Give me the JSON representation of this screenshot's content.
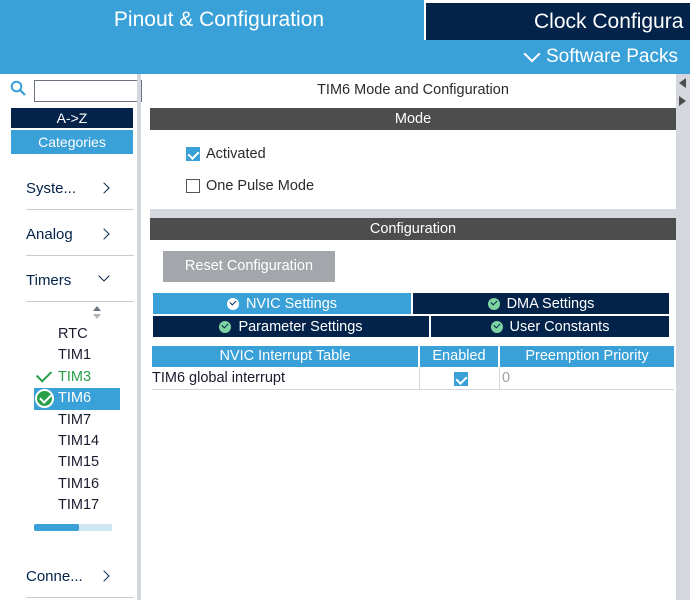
{
  "header": {
    "tab_pinout": "Pinout & Configuration",
    "tab_clock": "Clock Configura",
    "software_packs": "Software Packs"
  },
  "sidebar": {
    "search_placeholder": "",
    "az_label": "A->Z",
    "categories_label": "Categories",
    "groups": [
      {
        "label": "Syste...",
        "state": "collapsed"
      },
      {
        "label": "Analog",
        "state": "collapsed"
      },
      {
        "label": "Timers",
        "state": "expanded"
      }
    ],
    "timers": [
      {
        "label": "RTC",
        "status": "none"
      },
      {
        "label": "TIM1",
        "status": "none"
      },
      {
        "label": "TIM3",
        "status": "configured"
      },
      {
        "label": "TIM6",
        "status": "selected"
      },
      {
        "label": "TIM7",
        "status": "none"
      },
      {
        "label": "TIM14",
        "status": "none"
      },
      {
        "label": "TIM15",
        "status": "none"
      },
      {
        "label": "TIM16",
        "status": "none"
      },
      {
        "label": "TIM17",
        "status": "none"
      }
    ],
    "bottom_group": "Conne...",
    "scroll_fraction": 0.58
  },
  "panel": {
    "title": "TIM6 Mode and Configuration",
    "mode_header": "Mode",
    "activated_label": "Activated",
    "activated_checked": true,
    "one_pulse_label": "One Pulse Mode",
    "one_pulse_checked": false,
    "config_header": "Configuration",
    "reset_label": "Reset Configuration",
    "tabs": {
      "nvic": "NVIC Settings",
      "dma": "DMA Settings",
      "parameter": "Parameter Settings",
      "user_constants": "User Constants"
    },
    "table": {
      "headers": [
        "NVIC Interrupt Table",
        "Enabled",
        "Preemption Priority"
      ],
      "rows": [
        {
          "name": "TIM6 global interrupt",
          "enabled": true,
          "priority": "0"
        }
      ]
    }
  },
  "colors": {
    "accent": "#3aa0d8",
    "navy": "#03234b",
    "dark_bar": "#4d4d4d",
    "ok_green": "#29a048"
  }
}
